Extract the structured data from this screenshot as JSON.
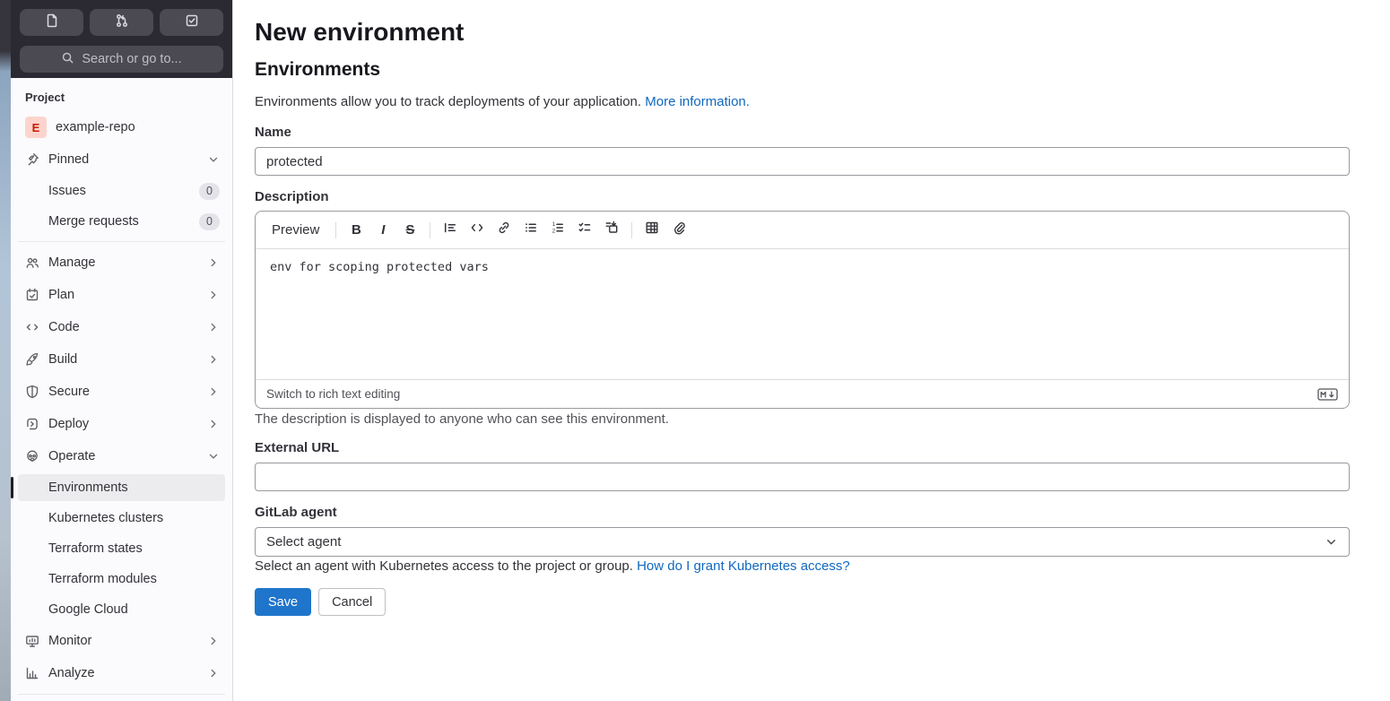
{
  "topbar": {
    "search_placeholder": "Search or go to...",
    "icons": [
      "issues-icon",
      "merge-requests-icon",
      "todo-list-icon",
      "search-icon"
    ]
  },
  "sidebar": {
    "section_label": "Project",
    "project": {
      "avatar_letter": "E",
      "name": "example-repo"
    },
    "items": [
      {
        "label": "Pinned"
      },
      {
        "label": "Issues",
        "badge": "0"
      },
      {
        "label": "Merge requests",
        "badge": "0"
      },
      {
        "label": "Manage"
      },
      {
        "label": "Plan"
      },
      {
        "label": "Code"
      },
      {
        "label": "Build"
      },
      {
        "label": "Secure"
      },
      {
        "label": "Deploy"
      },
      {
        "label": "Operate"
      },
      {
        "label": "Environments"
      },
      {
        "label": "Kubernetes clusters"
      },
      {
        "label": "Terraform states"
      },
      {
        "label": "Terraform modules"
      },
      {
        "label": "Google Cloud"
      },
      {
        "label": "Monitor"
      },
      {
        "label": "Analyze"
      }
    ]
  },
  "main": {
    "title": "New environment",
    "section_title": "Environments",
    "intro_text": "Environments allow you to track deployments of your application.",
    "intro_link": "More information.",
    "name_field": {
      "label": "Name",
      "value": "protected"
    },
    "description_field": {
      "label": "Description",
      "preview_tab": "Preview",
      "bold_glyph": "B",
      "italic_glyph": "I",
      "strike_glyph": "S",
      "value": "env for scoping protected vars",
      "switch_link": "Switch to rich text editing",
      "help": "The description is displayed to anyone who can see this environment."
    },
    "external_url_field": {
      "label": "External URL",
      "value": ""
    },
    "agent_field": {
      "label": "GitLab agent",
      "selected": "Select agent",
      "help": "Select an agent with Kubernetes access to the project or group.",
      "help_link": "How do I grant Kubernetes access?"
    },
    "actions": {
      "save": "Save",
      "cancel": "Cancel"
    }
  },
  "colors": {
    "accent_blue": "#1f75cb",
    "link_blue": "#1068bf",
    "sidebar_dark": "#2b2a32",
    "active_item_bg": "#ececef",
    "avatar_bg": "#fdd4cd",
    "avatar_text": "#c91c00"
  }
}
